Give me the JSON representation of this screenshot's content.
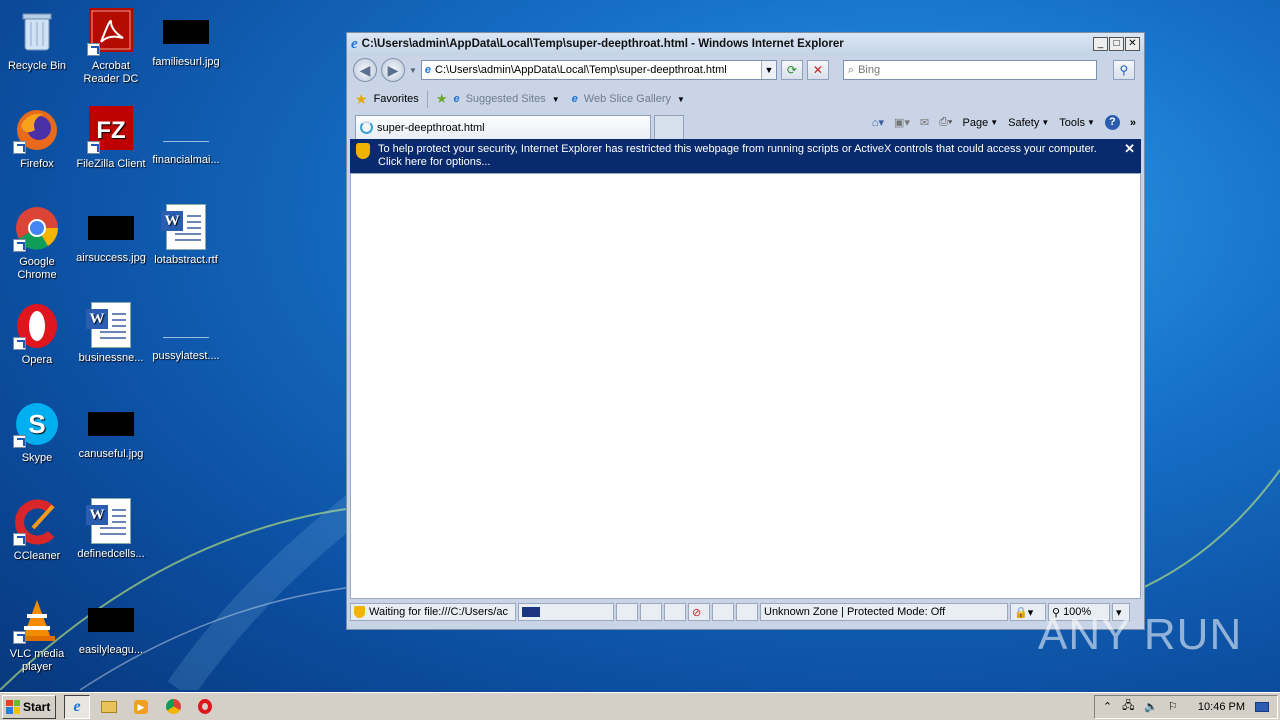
{
  "desktop": {
    "icons": [
      {
        "label": "Recycle Bin"
      },
      {
        "label": "Acrobat Reader DC"
      },
      {
        "label": "familiesurl.jpg"
      },
      {
        "label": "Firefox"
      },
      {
        "label": "FileZilla Client"
      },
      {
        "label": "financialmai..."
      },
      {
        "label": "Google Chrome"
      },
      {
        "label": "airsuccess.jpg"
      },
      {
        "label": "lotabstract.rtf"
      },
      {
        "label": "Opera"
      },
      {
        "label": "businessne..."
      },
      {
        "label": "pussylatest...."
      },
      {
        "label": "Skype"
      },
      {
        "label": "canuseful.jpg"
      },
      {
        "label": "CCleaner"
      },
      {
        "label": "definedcells..."
      },
      {
        "label": "VLC media player"
      },
      {
        "label": "easilyleagu..."
      }
    ]
  },
  "ie": {
    "title": "C:\\Users\\admin\\AppData\\Local\\Temp\\super-deepthroat.html - Windows Internet Explorer",
    "address": "C:\\Users\\admin\\AppData\\Local\\Temp\\super-deepthroat.html",
    "search_placeholder": "Bing",
    "favorites_label": "Favorites",
    "suggested_sites": "Suggested Sites",
    "web_slice_gallery": "Web Slice Gallery",
    "tab_title": "super-deepthroat.html",
    "cmd": {
      "page": "Page",
      "safety": "Safety",
      "tools": "Tools"
    },
    "infobar_text": "To help protect your security, Internet Explorer has restricted this webpage from running scripts or ActiveX controls that could access your computer. Click here for options...",
    "status": {
      "text": "Waiting for file:///C:/Users/ac",
      "zone": "Unknown Zone | Protected Mode: Off",
      "zoom": "100%",
      "progress": 0.2
    }
  },
  "taskbar": {
    "start_label": "Start",
    "clock": "10:46 PM"
  },
  "watermark": "ANY RUN"
}
